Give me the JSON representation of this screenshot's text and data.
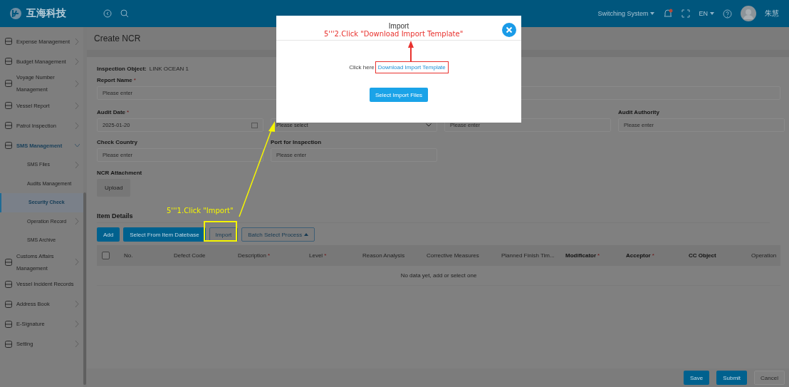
{
  "header": {
    "brand": "互海科技",
    "system_switch": "Switching System",
    "language": "EN",
    "user_name": "朱慧",
    "notification_dot": true
  },
  "sidebar": {
    "items": [
      {
        "label": "Expense Management",
        "expandable": true,
        "expanded": false,
        "selected": false
      },
      {
        "label": "Budget Management",
        "expandable": true,
        "expanded": false,
        "selected": false
      },
      {
        "label": "Voyage Number Management",
        "expandable": true,
        "expanded": false,
        "selected": false
      },
      {
        "label": "Vessel Report",
        "expandable": true,
        "expanded": false,
        "selected": false
      },
      {
        "label": "Patrol Inspection",
        "expandable": true,
        "expanded": false,
        "selected": false
      },
      {
        "label": "SMS Management",
        "expandable": true,
        "expanded": true,
        "selected": false,
        "children": [
          {
            "label": "SMS Files",
            "expandable": true,
            "selected": false
          },
          {
            "label": "Audits Management",
            "expandable": false,
            "selected": false
          },
          {
            "label": "Security Check",
            "expandable": false,
            "selected": true
          },
          {
            "label": "Operation Record",
            "expandable": true,
            "selected": false
          },
          {
            "label": "SMS Archive",
            "expandable": false,
            "selected": false
          }
        ]
      },
      {
        "label": "Customs Affairs Management",
        "expandable": true,
        "expanded": false,
        "selected": false
      },
      {
        "label": "Vessel Incident Records",
        "expandable": false,
        "expanded": false,
        "selected": false
      },
      {
        "label": "Address Book",
        "expandable": true,
        "expanded": false,
        "selected": false
      },
      {
        "label": "E-Signature",
        "expandable": true,
        "expanded": false,
        "selected": false
      },
      {
        "label": "Setting",
        "expandable": true,
        "expanded": false,
        "selected": false
      }
    ]
  },
  "page_title": "Create NCR",
  "form": {
    "inspection_object": {
      "label": "Inspection Object:",
      "value": "LINK OCEAN 1"
    },
    "report_name": {
      "label": "Report Name",
      "required_mark": "*",
      "placeholder": "Please enter"
    },
    "fields": [
      {
        "label": "Audit Date",
        "required_mark": "*",
        "kind": "date",
        "value": "2025-01-20"
      },
      {
        "kind": "select",
        "placeholder": "Please select"
      },
      {
        "kind": "text",
        "placeholder": "Please enter"
      },
      {
        "label": "Audit Authority",
        "kind": "text",
        "placeholder": "Please enter"
      },
      {
        "label": "Check Country",
        "kind": "text",
        "placeholder": "Please enter"
      },
      {
        "label": "Port for Inspection",
        "kind": "text",
        "placeholder": "Please enter"
      }
    ],
    "attachment": {
      "label": "NCR Attachment",
      "button": "Upload"
    }
  },
  "item_details": {
    "title": "Item Details",
    "buttons": [
      {
        "label": "Add",
        "kind": "primary"
      },
      {
        "label": "Select From Item Datebase",
        "kind": "primary"
      },
      {
        "label": "Import",
        "kind": "outline"
      },
      {
        "label": "Batch Select Process",
        "kind": "dropdown"
      }
    ],
    "columns": [
      {
        "label": "No.",
        "strong": false
      },
      {
        "label": "Defect Code",
        "strong": false
      },
      {
        "label": "Description",
        "required_mark": "*",
        "strong": false
      },
      {
        "label": "Level",
        "required_mark": "*",
        "strong": false
      },
      {
        "label": "Reason Analysis",
        "strong": false
      },
      {
        "label": "Corrective Measures",
        "strong": false
      },
      {
        "label": "Planned Finish Tim...",
        "strong": false
      },
      {
        "label": "Modificator",
        "required_mark": "*",
        "strong": true
      },
      {
        "label": "Acceptor",
        "required_mark": "*",
        "strong": true
      },
      {
        "label": "CC Object",
        "strong": true
      },
      {
        "label": "Operation",
        "strong": false
      }
    ],
    "select_all_checked": false,
    "empty_text": "No data yet, add or select one"
  },
  "footer_buttons": [
    {
      "label": "Save",
      "kind": "primary"
    },
    {
      "label": "Submit",
      "kind": "primary"
    },
    {
      "label": "Cancel",
      "kind": "plain"
    }
  ],
  "modal": {
    "title": "Import",
    "prompt": "Click here",
    "link": "Download Import Template",
    "button": "Select Import Files"
  },
  "annotations": [
    {
      "text": "5'''1.Click \"Import\"",
      "kind": "yellow"
    },
    {
      "text": "5'''2.Click \"Download Import Template\"",
      "kind": "red"
    }
  ]
}
